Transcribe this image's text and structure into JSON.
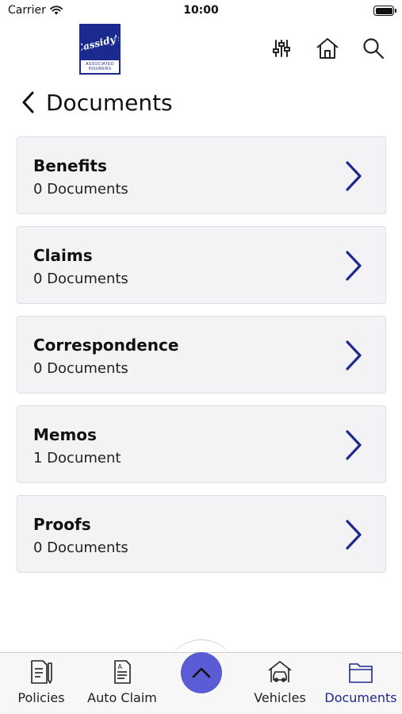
{
  "status_bar": {
    "carrier": "Carrier",
    "time": "10:00"
  },
  "header": {
    "logo_script": "Cassidy's",
    "logo_line1": "ASSOCIATED",
    "logo_line2": "INSURERS"
  },
  "page": {
    "title": "Documents"
  },
  "categories": [
    {
      "title": "Benefits",
      "count": "0 Documents"
    },
    {
      "title": "Claims",
      "count": "0 Documents"
    },
    {
      "title": "Correspondence",
      "count": "0 Documents"
    },
    {
      "title": "Memos",
      "count": "1 Document"
    },
    {
      "title": "Proofs",
      "count": "0 Documents"
    }
  ],
  "tabbar": {
    "tabs": [
      {
        "label": "Policies",
        "icon": "policies-icon"
      },
      {
        "label": "Auto Claim",
        "icon": "auto-claim-icon"
      },
      {
        "label": "Vehicles",
        "icon": "vehicles-icon"
      },
      {
        "label": "Documents",
        "icon": "documents-icon",
        "active": true
      }
    ],
    "center_icon": "chevron-up-icon"
  },
  "colors": {
    "accent": "#1d2a8c",
    "fab": "#5b5bd6",
    "card_bg": "#f3f3f6"
  }
}
